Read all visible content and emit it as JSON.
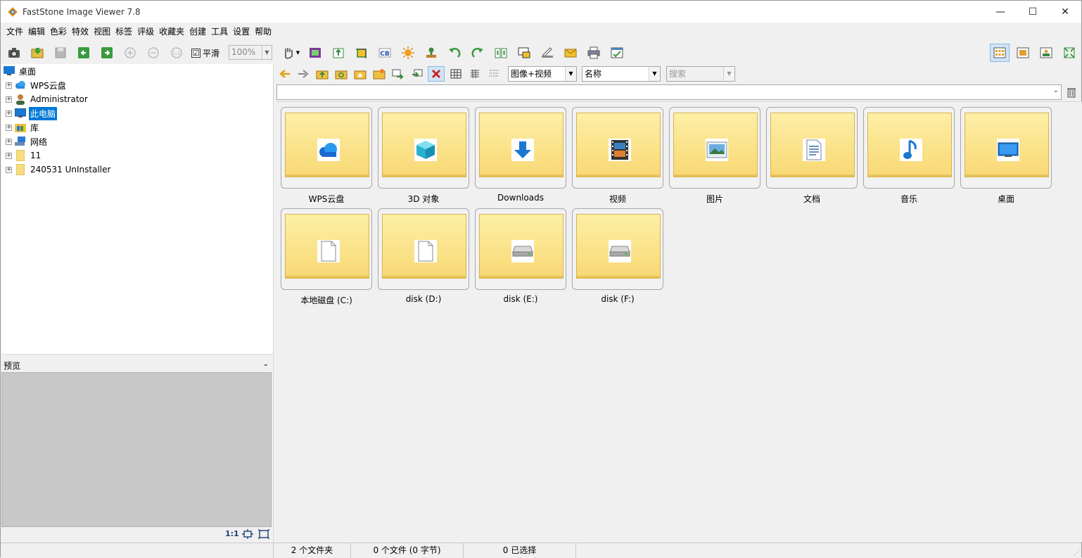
{
  "window": {
    "title": "FastStone Image Viewer 7.8",
    "minimize_glyph": "—",
    "maximize_glyph": "☐",
    "close_glyph": "✕"
  },
  "menu": [
    "文件",
    "编辑",
    "色彩",
    "特效",
    "视图",
    "标签",
    "评级",
    "收藏夹",
    "创建",
    "工具",
    "设置",
    "帮助"
  ],
  "toolbar": {
    "smooth_label": "平滑",
    "smooth_checked": "☑",
    "zoom_value": "100%",
    "buttons": [
      "camera-icon",
      "open-folder-icon",
      "save-icon",
      "prev-icon",
      "next-icon",
      "zoom-in-icon",
      "zoom-out-icon",
      "actual-size-icon",
      "hand-tool-icon",
      "slideshow-icon",
      "export-icon",
      "crop-icon",
      "color-balance-icon",
      "brightness-icon",
      "stamp-icon",
      "rotate-left-icon",
      "rotate-right-icon",
      "compare-icon",
      "screen-capture-icon",
      "scanner-icon",
      "email-icon",
      "print-icon",
      "batch-icon"
    ],
    "view_buttons": [
      "thumbnails-view-icon",
      "preview-view-icon",
      "browser-view-icon",
      "fullscreen-icon"
    ]
  },
  "tree": {
    "items": [
      {
        "label": "桌面",
        "icon": "desktop-icon",
        "level": 0
      },
      {
        "label": "WPS云盘",
        "icon": "cloud-icon",
        "level": 1
      },
      {
        "label": "Administrator",
        "icon": "user-icon",
        "level": 1
      },
      {
        "label": "此电脑",
        "icon": "computer-icon",
        "level": 1,
        "selected": true
      },
      {
        "label": "库",
        "icon": "library-icon",
        "level": 1
      },
      {
        "label": "网络",
        "icon": "network-icon",
        "level": 1
      },
      {
        "label": "11",
        "icon": "folder-icon",
        "level": 1
      },
      {
        "label": "240531 UnInstaller",
        "icon": "folder-icon",
        "level": 1
      }
    ]
  },
  "preview": {
    "label": "预览",
    "ratio": "1:1"
  },
  "nav": {
    "filter_value": "图像+视频",
    "sort_value": "名称",
    "search_placeholder": "搜索",
    "path_value": ""
  },
  "thumbnails": [
    {
      "caption": "WPS云盘",
      "icon": "cloud-icon"
    },
    {
      "caption": "3D 对象",
      "icon": "cube-icon"
    },
    {
      "caption": "Downloads",
      "icon": "download-icon"
    },
    {
      "caption": "视频",
      "icon": "video-icon"
    },
    {
      "caption": "图片",
      "icon": "picture-icon"
    },
    {
      "caption": "文档",
      "icon": "document-icon"
    },
    {
      "caption": "音乐",
      "icon": "music-icon"
    },
    {
      "caption": "桌面",
      "icon": "desktop-icon"
    },
    {
      "caption": "本地磁盘 (C:)",
      "icon": "blank-drive-icon"
    },
    {
      "caption": "disk (D:)",
      "icon": "blank-drive-icon"
    },
    {
      "caption": "disk (E:)",
      "icon": "drive-icon"
    },
    {
      "caption": "disk (F:)",
      "icon": "drive-icon"
    }
  ],
  "status": {
    "folders": "2 个文件夹",
    "files": "0 个文件 (0 字节)",
    "selected": "0 已选择"
  },
  "colors": {
    "selection": "#0078d7",
    "folder_top": "#fdefa6",
    "folder_bottom": "#f8d874"
  }
}
